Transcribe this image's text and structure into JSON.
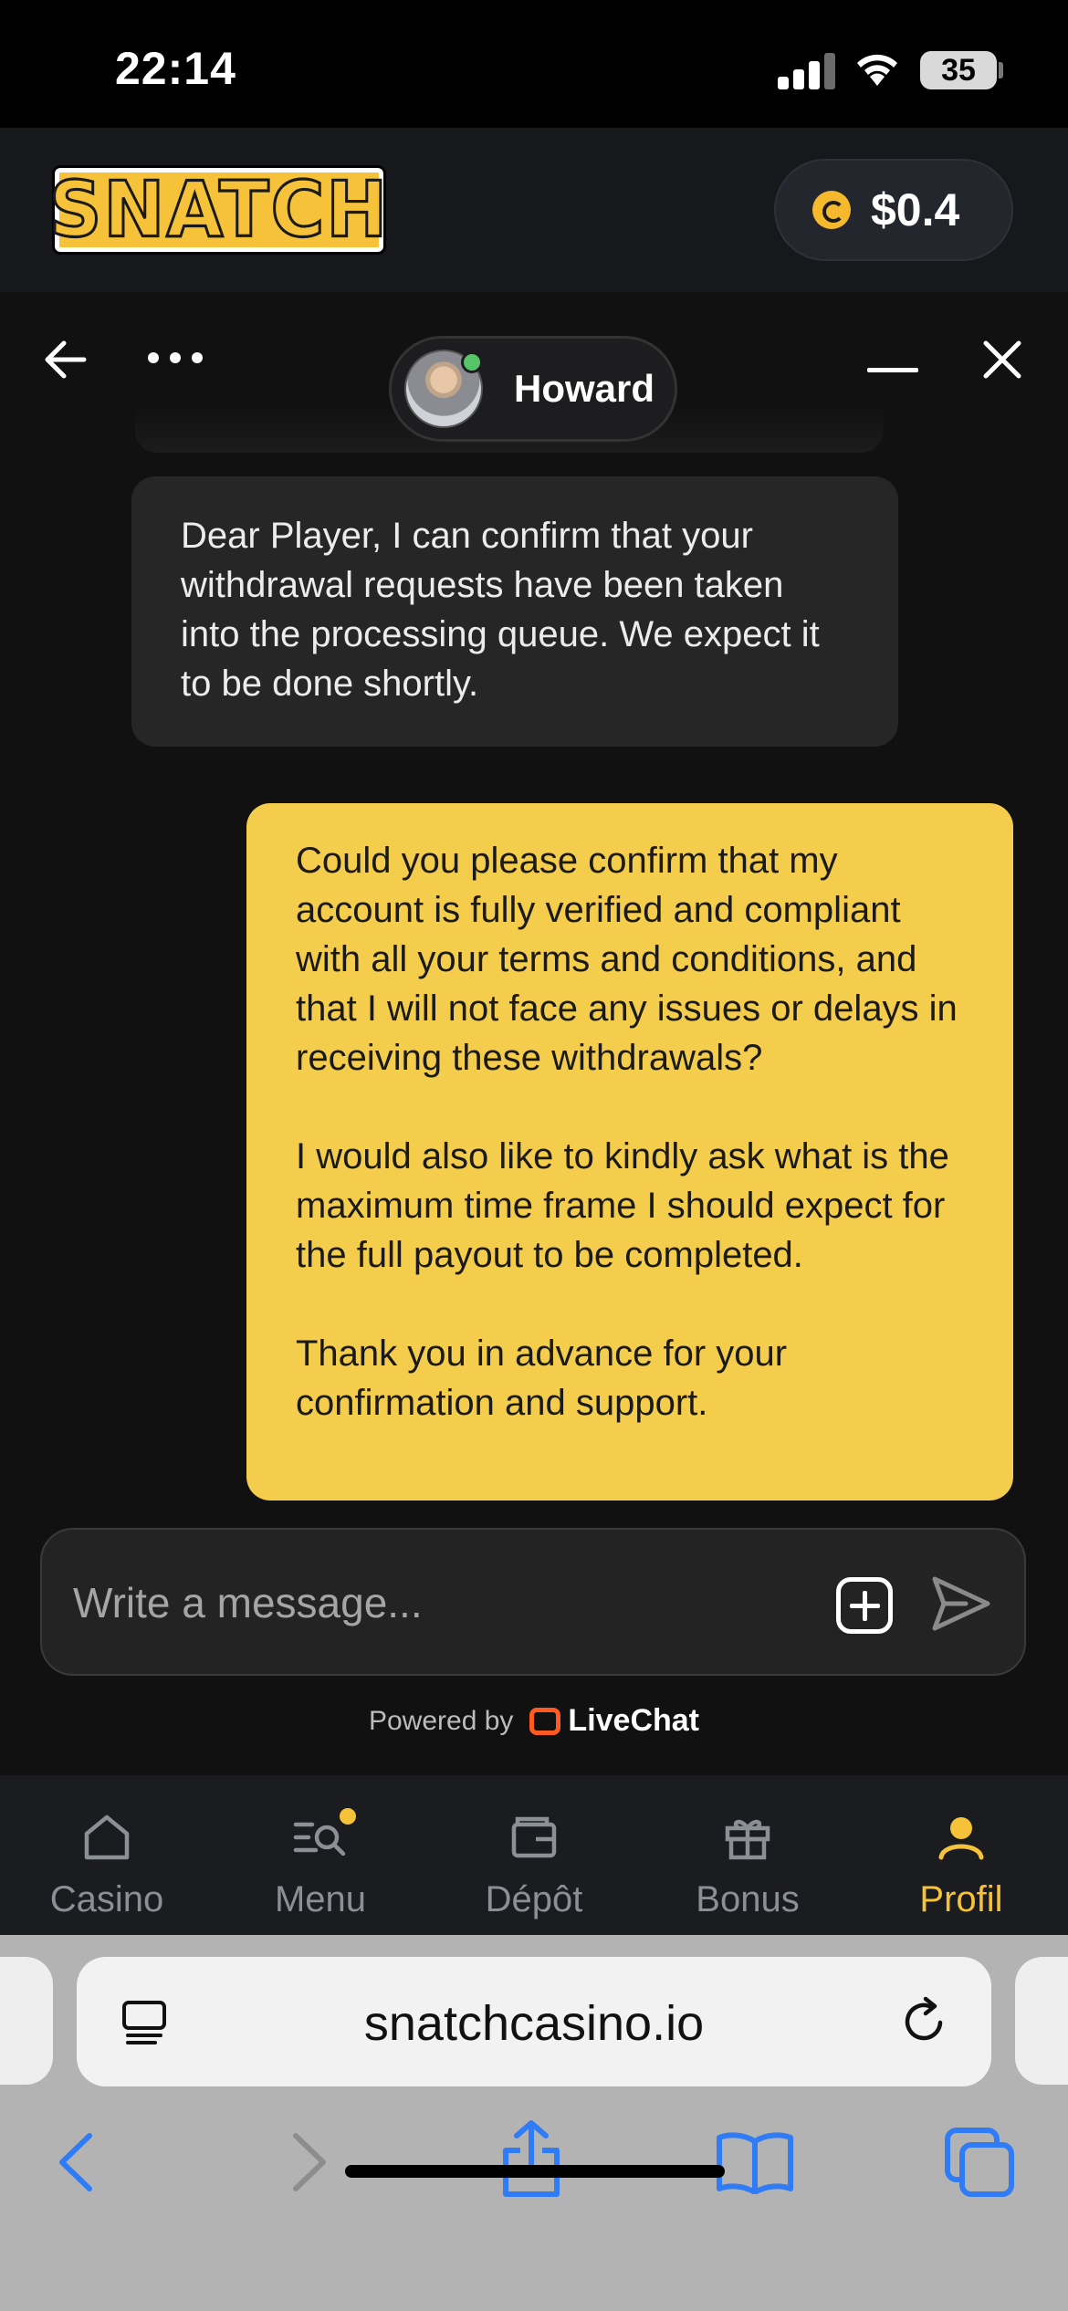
{
  "status_bar": {
    "time": "22:14",
    "battery": "35"
  },
  "header": {
    "logo_text": "SNATCH",
    "balance": "$0.4"
  },
  "chat": {
    "agent_name": "Howard",
    "messages": [
      {
        "from": "agent",
        "text": "Dear Player, I can confirm that your withdrawal requests have been taken into the processing queue. We expect it to be done shortly."
      },
      {
        "from": "user",
        "text": "Could you please confirm that my account is fully verified and compliant with all your terms and conditions, and that I will not face any issues or delays in receiving these withdrawals?\n\nI would also like to kindly ask what is the maximum time frame I should expect for the full payout to be completed.\n\nThank you in advance for your confirmation and support."
      }
    ],
    "composer_placeholder": "Write a message...",
    "powered_by": "Powered by",
    "brand": "LiveChat"
  },
  "nav": {
    "items": [
      {
        "label": "Casino",
        "icon": "home-icon"
      },
      {
        "label": "Menu",
        "icon": "menu-search-icon"
      },
      {
        "label": "Dépôt",
        "icon": "wallet-icon"
      },
      {
        "label": "Bonus",
        "icon": "gift-icon"
      },
      {
        "label": "Profil",
        "icon": "profile-icon"
      }
    ],
    "active": "Profil"
  },
  "browser": {
    "url": "snatchcasino.io"
  },
  "colors": {
    "accent": "#f5c23a",
    "user_bubble": "#f4cd4d",
    "agent_bubble": "#262626",
    "safari_blue": "#2f7cf6"
  }
}
